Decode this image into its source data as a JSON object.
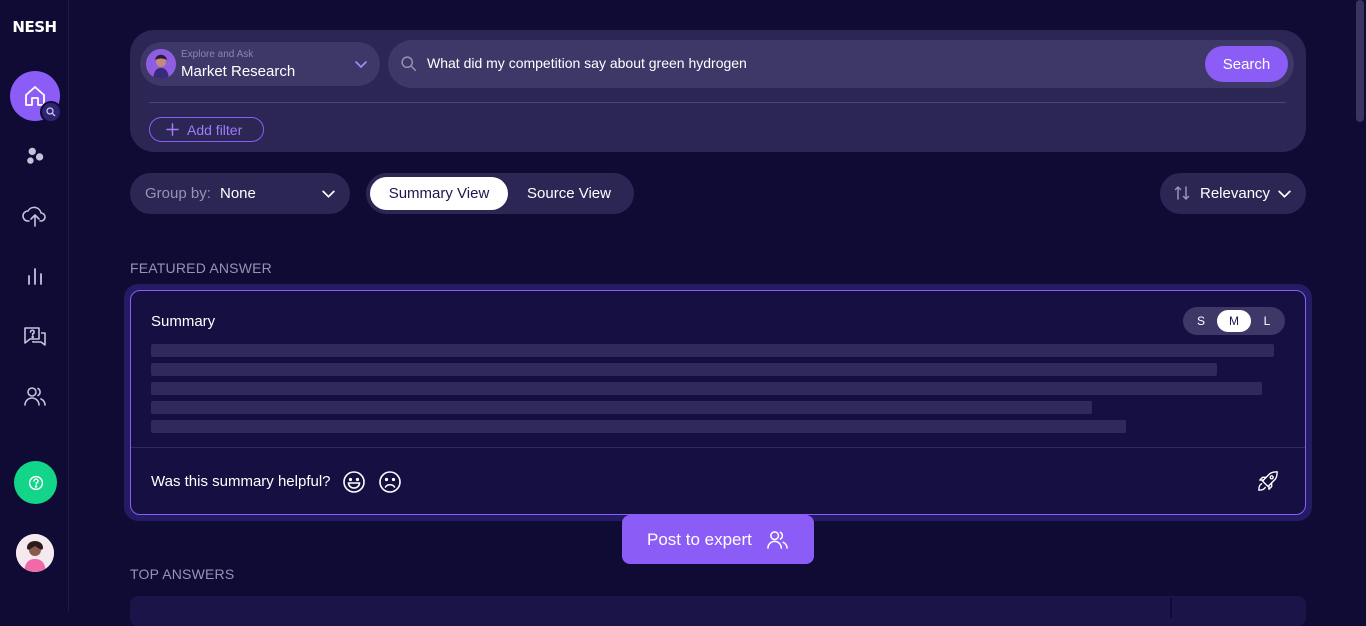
{
  "brand": {
    "logo": "NESH"
  },
  "search": {
    "mode_small": "Explore and Ask",
    "mode_label": "Market Research",
    "query": "What did my competition say about green hydrogen",
    "button": "Search",
    "add_filter": "Add filter"
  },
  "toolbar": {
    "group_by_label": "Group by:",
    "group_by_value": "None",
    "view_summary": "Summary View",
    "view_source": "Source View",
    "sort_label": "Relevancy"
  },
  "featured": {
    "section_title": "FEATURED ANSWER",
    "card_title": "Summary",
    "sizes": [
      "S",
      "M",
      "L"
    ],
    "active_size": "M",
    "helpful_question": "Was this summary helpful?"
  },
  "post_expert": "Post to expert",
  "top_answers": {
    "section_title": "TOP ANSWERS"
  },
  "colors": {
    "accent": "#8b5cf6",
    "background": "#0f0b35",
    "panel": "#2c2655",
    "success": "#12d58a"
  }
}
